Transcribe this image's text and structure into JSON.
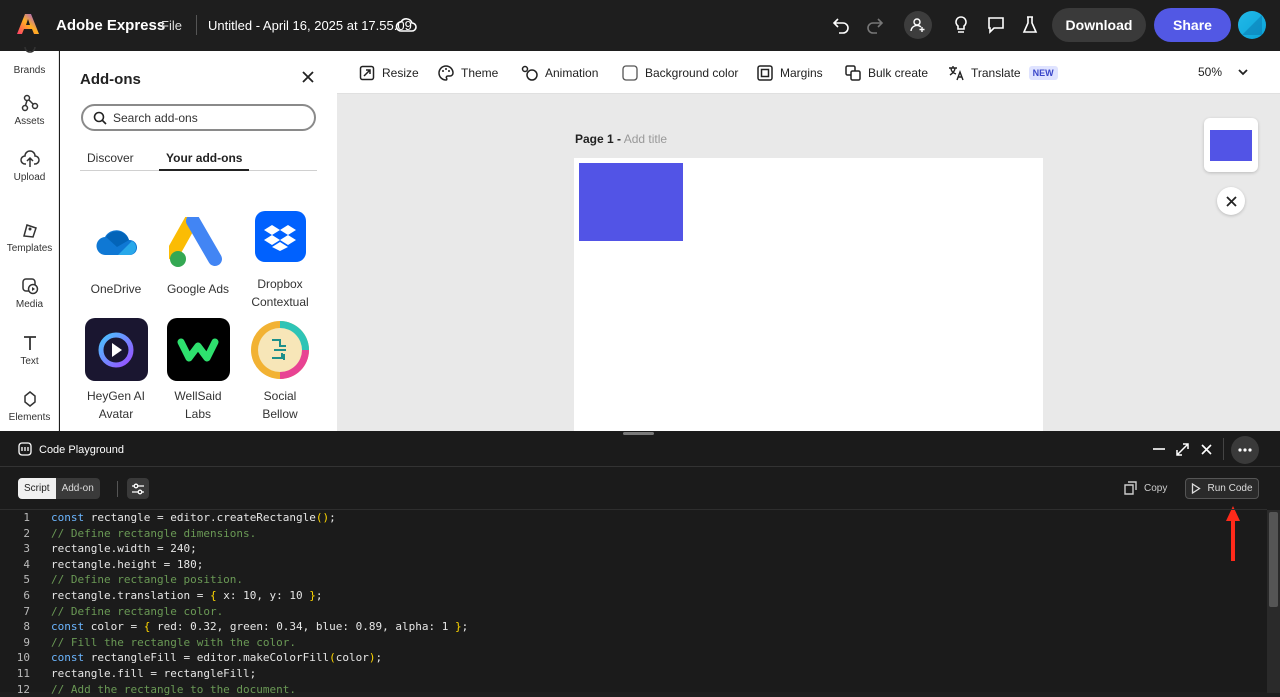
{
  "header": {
    "app_name": "Adobe Express",
    "file_menu": "File",
    "doc_title": "Untitled - April 16, 2025 at 17.55.09",
    "download_label": "Download",
    "share_label": "Share",
    "accent": "#5258e4"
  },
  "rail": {
    "items": [
      {
        "label": "Brands",
        "icon": "brands-icon"
      },
      {
        "label": "Assets",
        "icon": "assets-icon"
      },
      {
        "label": "Upload",
        "icon": "upload-icon"
      },
      {
        "label": "Templates",
        "icon": "templates-icon"
      },
      {
        "label": "Media",
        "icon": "media-icon"
      },
      {
        "label": "Text",
        "icon": "text-icon"
      },
      {
        "label": "Elements",
        "icon": "elements-icon"
      }
    ]
  },
  "addons": {
    "title": "Add-ons",
    "search_placeholder": "Search add-ons",
    "tabs": [
      "Discover",
      "Your add-ons"
    ],
    "active_tab": "Your add-ons",
    "items": [
      {
        "line1": "OneDrive",
        "line2": ""
      },
      {
        "line1": "Google Ads",
        "line2": ""
      },
      {
        "line1": "Dropbox",
        "line2": "Contextual"
      },
      {
        "line1": "HeyGen AI",
        "line2": "Avatar"
      },
      {
        "line1": "WellSaid",
        "line2": "Labs"
      },
      {
        "line1": "Social",
        "line2": "Bellow"
      }
    ]
  },
  "toolbar": {
    "resize": "Resize",
    "theme": "Theme",
    "animation": "Animation",
    "background_color": "Background color",
    "margins": "Margins",
    "bulk_create": "Bulk create",
    "translate": "Translate",
    "new_badge": "NEW",
    "zoom": "50%"
  },
  "canvas": {
    "page_label": "Page 1 -",
    "page_title_placeholder": "Add title",
    "rect_color": "#5254e6"
  },
  "playground": {
    "title": "Code Playground",
    "mode_script": "Script",
    "mode_addon": "Add-on",
    "copy_label": "Copy",
    "run_label": "Run Code",
    "line_numbers": [
      "1",
      "2",
      "3",
      "4",
      "5",
      "6",
      "7",
      "8",
      "9",
      "10",
      "11",
      "12"
    ],
    "code": {
      "l1a": "const",
      "l1b": " rectangle = editor.createRectangle",
      "l1c": "()",
      "l1d": ";",
      "l2": "// Define rectangle dimensions.",
      "l3": "rectangle.width = 240;",
      "l4": "rectangle.height = 180;",
      "l5": "// Define rectangle position.",
      "l6a": "rectangle.translation = ",
      "l6b": "{",
      "l6c": " x: 10, y: 10 ",
      "l6d": "}",
      "l6e": ";",
      "l7": "// Define rectangle color.",
      "l8a": "const",
      "l8b": " color = ",
      "l8c": "{",
      "l8d": " red: 0.32, green: 0.34, blue: 0.89, alpha: 1 ",
      "l8e": "}",
      "l8f": ";",
      "l9": "// Fill the rectangle with the color.",
      "l10a": "const",
      "l10b": " rectangleFill = editor.makeColorFill",
      "l10c": "(",
      "l10d": "color",
      "l10e": ")",
      "l10f": ";",
      "l11": "rectangle.fill = rectangleFill;",
      "l12": "// Add the rectangle to the document."
    }
  }
}
